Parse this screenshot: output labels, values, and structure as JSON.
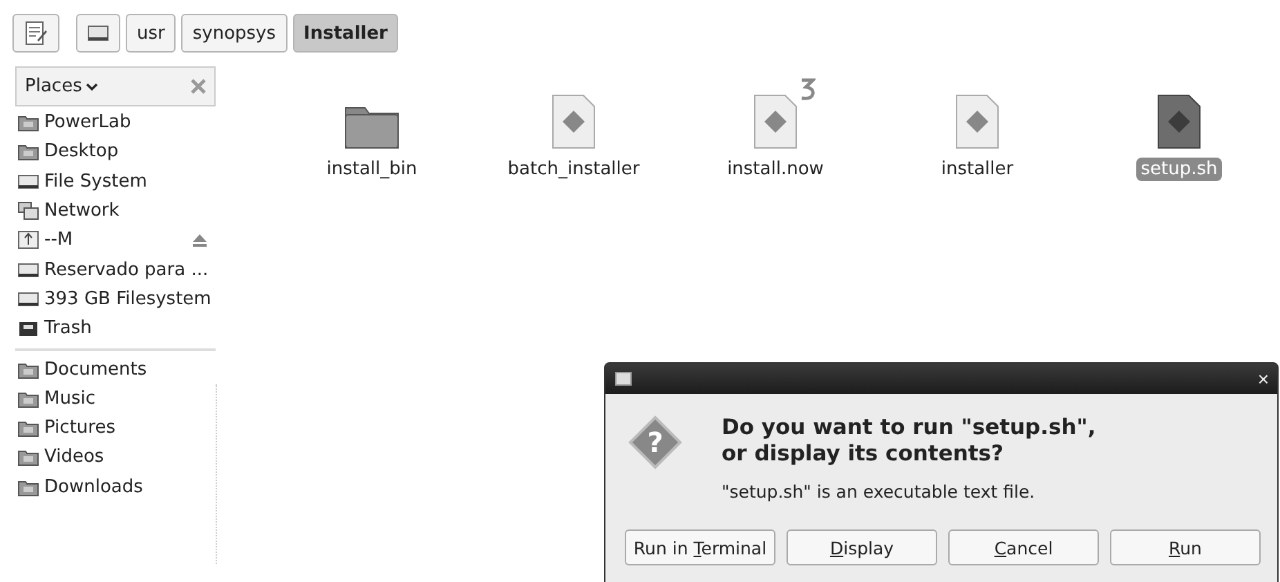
{
  "toolbar": {
    "path": [
      {
        "kind": "drive",
        "selected": false
      },
      {
        "label": "usr",
        "kind": "text",
        "selected": false
      },
      {
        "label": "synopsys",
        "kind": "text",
        "selected": false
      },
      {
        "label": "Installer",
        "kind": "text",
        "selected": true
      }
    ]
  },
  "sidebar": {
    "title": "Places",
    "sections": [
      [
        {
          "label": "PowerLab",
          "kind": "home",
          "eject": false
        },
        {
          "label": "Desktop",
          "kind": "desktop",
          "eject": false
        },
        {
          "label": "File System",
          "kind": "drive",
          "eject": false
        },
        {
          "label": "Network",
          "kind": "network",
          "eject": false
        },
        {
          "label": "--M",
          "kind": "removable",
          "eject": true
        },
        {
          "label": "Reservado para ...",
          "kind": "drive",
          "eject": false
        },
        {
          "label": "393 GB Filesystem",
          "kind": "drive",
          "eject": false
        },
        {
          "label": "Trash",
          "kind": "trash",
          "eject": false
        }
      ],
      [
        {
          "label": "Documents",
          "kind": "folder",
          "eject": false
        },
        {
          "label": "Music",
          "kind": "folder",
          "eject": false
        },
        {
          "label": "Pictures",
          "kind": "folder",
          "eject": false
        },
        {
          "label": "Videos",
          "kind": "folder",
          "eject": false
        },
        {
          "label": "Downloads",
          "kind": "folder",
          "eject": false
        }
      ]
    ]
  },
  "files": [
    {
      "name": "install_bin",
      "kind": "folder",
      "selected": false,
      "emblem": false
    },
    {
      "name": "batch_installer",
      "kind": "script",
      "selected": false,
      "emblem": false
    },
    {
      "name": "install.now",
      "kind": "script",
      "selected": false,
      "emblem": true
    },
    {
      "name": "installer",
      "kind": "script",
      "selected": false,
      "emblem": false
    },
    {
      "name": "setup.sh",
      "kind": "script",
      "selected": true,
      "emblem": false
    }
  ],
  "dialog": {
    "close": "×",
    "icon": "?",
    "heading": "Do you want to run \"setup.sh\",\nor display its contents?",
    "message": "\"setup.sh\" is an executable text file.",
    "buttons": [
      {
        "before": "Run in ",
        "mnemonic": "T",
        "after": "erminal"
      },
      {
        "mnemonic": "D",
        "after": "isplay"
      },
      {
        "mnemonic": "C",
        "after": "ancel"
      },
      {
        "mnemonic": "R",
        "after": "un"
      }
    ]
  }
}
